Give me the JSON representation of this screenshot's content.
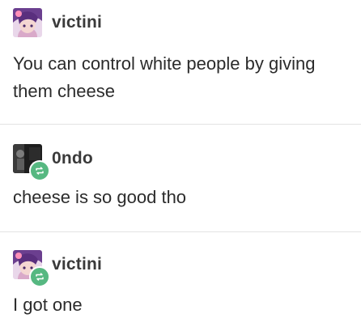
{
  "posts": [
    {
      "username": "victini",
      "avatar": "anime-girl-avatar",
      "reblogged": false,
      "text": "You can control white people by giving them cheese"
    },
    {
      "username": "0ndo",
      "avatar": "dark-photo-avatar",
      "reblogged": true,
      "text": "cheese is so good tho"
    },
    {
      "username": "victini",
      "avatar": "anime-girl-avatar",
      "reblogged": true,
      "text": "I got one"
    }
  ],
  "colors": {
    "reblog_badge": "#56b881",
    "divider": "#e3e3e3",
    "text": "#2b2b2b"
  }
}
